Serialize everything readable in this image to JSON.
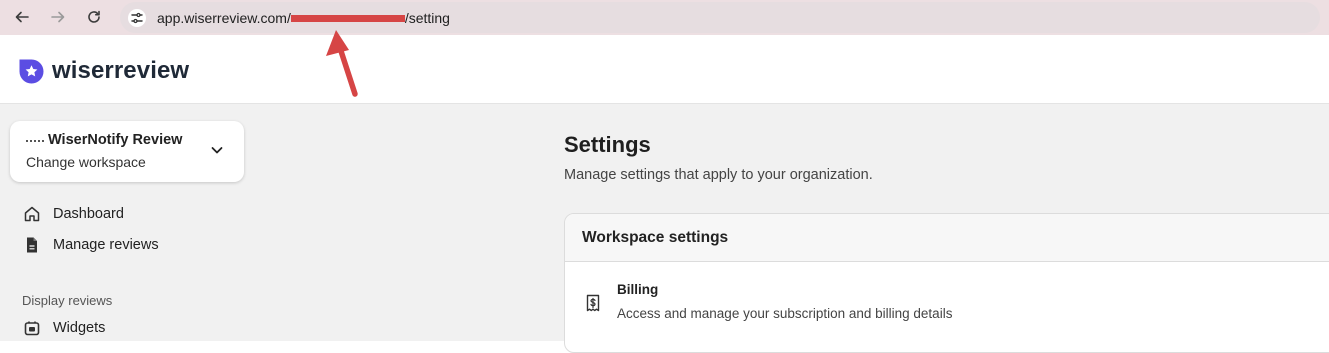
{
  "browser": {
    "url_prefix": "app.wiserreview.com/",
    "url_suffix": "/setting"
  },
  "header": {
    "brand": "wiserreview"
  },
  "sidebar": {
    "workspace": {
      "name": "WiserNotify Review",
      "change_label": "Change workspace"
    },
    "items": [
      {
        "label": "Dashboard",
        "icon": "home-icon"
      },
      {
        "label": "Manage reviews",
        "icon": "document-icon"
      }
    ],
    "section_label": "Display reviews",
    "section_items": [
      {
        "label": "Widgets",
        "icon": "widget-icon"
      }
    ]
  },
  "main": {
    "title": "Settings",
    "subtitle": "Manage settings that apply to your organization.",
    "panel": {
      "title": "Workspace settings",
      "rows": [
        {
          "title": "Billing",
          "description": "Access and manage your subscription and billing details",
          "icon": "receipt-icon"
        }
      ]
    }
  },
  "colors": {
    "chrome_bg": "#eddfe2",
    "brand_purple": "#5b4de3",
    "annotation_red": "#d64545",
    "content_bg": "#f1f1f1"
  }
}
